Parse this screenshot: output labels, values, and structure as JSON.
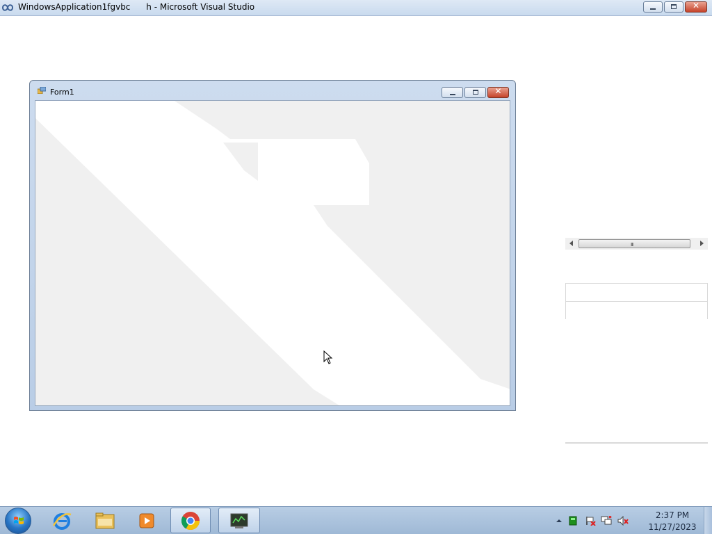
{
  "vs_window": {
    "title": "WindowsApplication1fgvbc      h - Microsoft Visual Studio",
    "buttons": [
      "minimize",
      "restore",
      "close"
    ]
  },
  "form_window": {
    "title": "Form1",
    "buttons": [
      "minimize",
      "maximize",
      "close"
    ]
  },
  "designer": {
    "hscrollbar_grip": "III"
  },
  "taskbar": {
    "items": [
      {
        "name": "start-orb",
        "icon": "windows-flag-icon"
      },
      {
        "name": "internet-explorer",
        "icon": "ie-icon"
      },
      {
        "name": "windows-explorer",
        "icon": "folder-icon"
      },
      {
        "name": "media-player",
        "icon": "media-player-icon"
      },
      {
        "name": "chrome",
        "icon": "chrome-icon",
        "active": true
      },
      {
        "name": "visual-studio-app",
        "icon": "app-window-icon",
        "active": true
      }
    ],
    "tray": {
      "icons": [
        "show-hidden-icons-arrow",
        "network-activity-icon",
        "action-center-flag-icon",
        "network-icon",
        "volume-muted-icon"
      ],
      "time": "2:37 PM",
      "date": "11/27/2023"
    }
  },
  "colors": {
    "titlebar": "#c9daee",
    "taskbar": "#9fb9d6",
    "form_client": "#f0f0f0",
    "close_button": "#c5432a"
  }
}
